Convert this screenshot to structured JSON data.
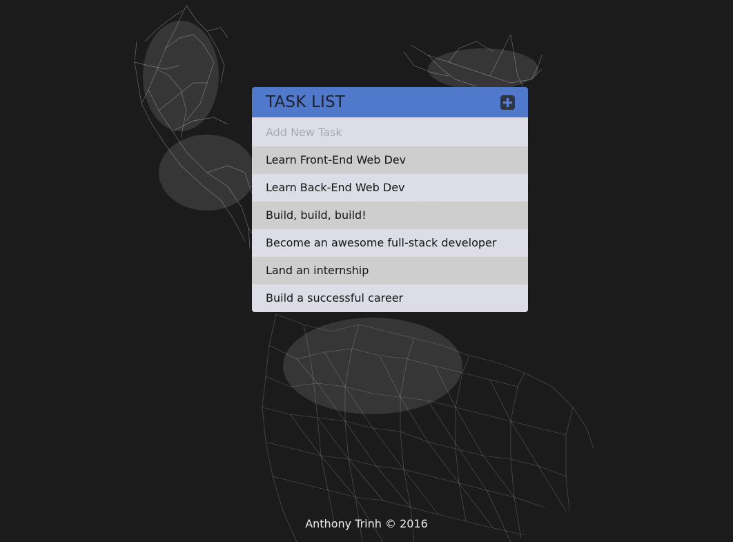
{
  "task_list": {
    "title": "TASK LIST",
    "add_icon": "plus-square-icon",
    "input_placeholder": "Add New Task",
    "input_value": "",
    "items": [
      "Learn Front-End Web Dev",
      "Learn Back-End Web Dev",
      "Build, build, build!",
      "Become an awesome full-stack developer",
      "Land an internship",
      "Build a successful career"
    ]
  },
  "footer": {
    "text": "Anthony Trinh © 2016"
  },
  "colors": {
    "background": "#1b1b1b",
    "header": "#527dd2",
    "row_light": "#e4e4ee",
    "row_dark": "#d8d8d8"
  }
}
